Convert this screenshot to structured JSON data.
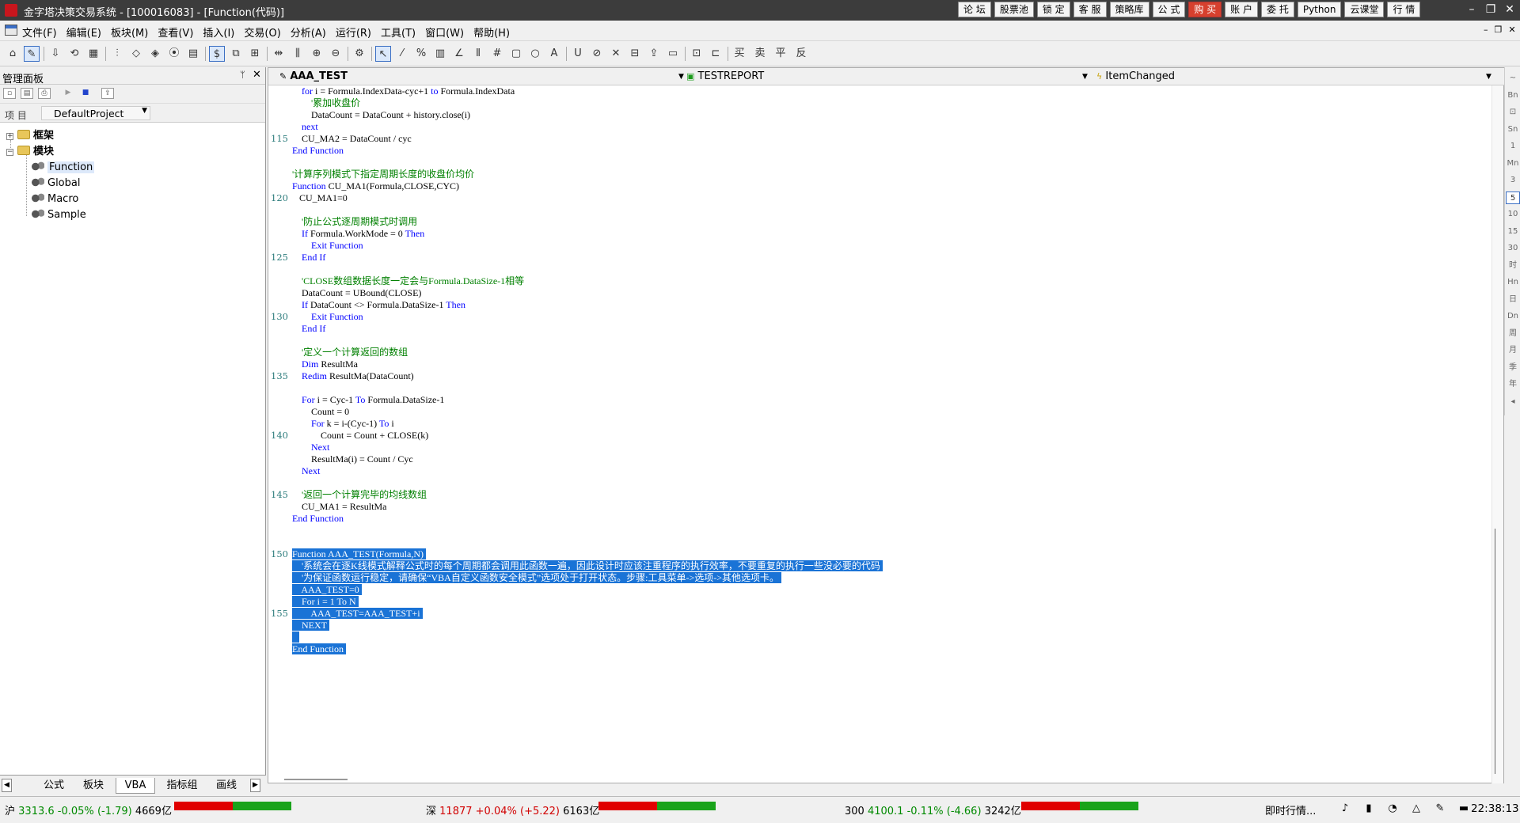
{
  "window": {
    "title": "金字塔决策交易系统 - [100016083] - [Function(代码)]"
  },
  "top_links": [
    "论 坛",
    "股票池",
    "锁 定",
    "客 服",
    "策略库",
    "公 式",
    "购 买",
    "账 户",
    "委 托",
    "Python",
    "云课堂",
    "行 情"
  ],
  "window_controls": [
    "–",
    "❐",
    "✕"
  ],
  "menu": [
    "文件(F)",
    "编辑(E)",
    "板块(M)",
    "查看(V)",
    "插入(I)",
    "交易(O)",
    "分析(A)",
    "运行(R)",
    "工具(T)",
    "窗口(W)",
    "帮助(H)"
  ],
  "mdi_controls": [
    "–",
    "❐",
    "✕"
  ],
  "toolbar_glyphs": [
    "⌂",
    "✎",
    "⇩",
    "⟲",
    "▦",
    "⫶",
    "◇",
    "◈",
    "⦿",
    "▤",
    "$",
    "⧉",
    "⊞",
    "⇹",
    "⫼",
    "⊕",
    "⊖",
    "⚙",
    "↖",
    "⁄",
    "%",
    "▥",
    "∠",
    "⫴",
    "#",
    "▢",
    "○",
    "A",
    "U",
    "⊘",
    "✕",
    "⊟",
    "⇪",
    "▭",
    "⊡",
    "⊏",
    "买",
    "卖",
    "平",
    "反"
  ],
  "panel": {
    "title": "管理面板",
    "pin": "ᛘ",
    "close": "✕",
    "project_label": "项  目",
    "project_value": "DefaultProject",
    "tree": [
      {
        "label": "框架",
        "toggle": "+"
      },
      {
        "label": "模块",
        "toggle": "−"
      },
      {
        "label": "Function"
      },
      {
        "label": "Global"
      },
      {
        "label": "Macro"
      },
      {
        "label": "Sample"
      }
    ],
    "tabs": [
      "公式",
      "板块",
      "VBA",
      "指标组",
      "画线"
    ],
    "tab_arrows": [
      "◀",
      "▶"
    ]
  },
  "editor": {
    "object_combo": "AAA_TEST",
    "report_combo": "TESTREPORT",
    "event_combo": "ItemChanged"
  },
  "line_numbers": [
    "115",
    "120",
    "125",
    "130",
    "135",
    "140",
    "145",
    "150",
    "155"
  ],
  "code_lines": [
    [
      {
        "t": "    "
      },
      {
        "t": "for",
        "k": "kw"
      },
      {
        "t": " i = Formula.IndexData-cyc+1 "
      },
      {
        "t": "to",
        "k": "kw"
      },
      {
        "t": " Formula.IndexData"
      }
    ],
    [
      {
        "t": "        "
      },
      {
        "t": "'累加收盘价",
        "k": "cm"
      }
    ],
    [
      {
        "t": "        DataCount = DataCount + history.close(i)"
      }
    ],
    [
      {
        "t": "    "
      },
      {
        "t": "next",
        "k": "kw"
      }
    ],
    [
      {
        "t": "    CU_MA2 = DataCount / cyc"
      }
    ],
    [
      {
        "t": "End Function",
        "k": "kw"
      }
    ],
    [
      {
        "t": ""
      }
    ],
    [
      {
        "t": "'计算序列模式下指定周期长度的收盘价均价",
        "k": "cm"
      }
    ],
    [
      {
        "t": "Function",
        "k": "kw"
      },
      {
        "t": " CU_MA1(Formula,CLOSE,CYC)"
      }
    ],
    [
      {
        "t": "   CU_MA1=0"
      }
    ],
    [
      {
        "t": ""
      }
    ],
    [
      {
        "t": "    "
      },
      {
        "t": "'防止公式逐周期模式时调用",
        "k": "cm"
      }
    ],
    [
      {
        "t": "    "
      },
      {
        "t": "If",
        "k": "kw"
      },
      {
        "t": " Formula.WorkMode = 0 "
      },
      {
        "t": "Then",
        "k": "kw"
      }
    ],
    [
      {
        "t": "        "
      },
      {
        "t": "Exit Function",
        "k": "kw"
      }
    ],
    [
      {
        "t": "    "
      },
      {
        "t": "End If",
        "k": "kw"
      }
    ],
    [
      {
        "t": ""
      }
    ],
    [
      {
        "t": "    "
      },
      {
        "t": "'CLOSE数组数据长度一定会与Formula.DataSize-1相等",
        "k": "cm"
      }
    ],
    [
      {
        "t": "    DataCount = UBound(CLOSE)"
      }
    ],
    [
      {
        "t": "    "
      },
      {
        "t": "If",
        "k": "kw"
      },
      {
        "t": " DataCount <> Formula.DataSize-1 "
      },
      {
        "t": "Then",
        "k": "kw"
      }
    ],
    [
      {
        "t": "        "
      },
      {
        "t": "Exit Function",
        "k": "kw"
      }
    ],
    [
      {
        "t": "    "
      },
      {
        "t": "End If",
        "k": "kw"
      }
    ],
    [
      {
        "t": ""
      }
    ],
    [
      {
        "t": "    "
      },
      {
        "t": "'定义一个计算返回的数组",
        "k": "cm"
      }
    ],
    [
      {
        "t": "    "
      },
      {
        "t": "Dim",
        "k": "kw"
      },
      {
        "t": " ResultMa"
      }
    ],
    [
      {
        "t": "    "
      },
      {
        "t": "Redim",
        "k": "kw"
      },
      {
        "t": " ResultMa(DataCount)"
      }
    ],
    [
      {
        "t": ""
      }
    ],
    [
      {
        "t": "    "
      },
      {
        "t": "For",
        "k": "kw"
      },
      {
        "t": " i = Cyc-1 "
      },
      {
        "t": "To",
        "k": "kw"
      },
      {
        "t": " Formula.DataSize-1"
      }
    ],
    [
      {
        "t": "        Count = 0"
      }
    ],
    [
      {
        "t": "        "
      },
      {
        "t": "For",
        "k": "kw"
      },
      {
        "t": " k = i-(Cyc-1) "
      },
      {
        "t": "To",
        "k": "kw"
      },
      {
        "t": " i"
      }
    ],
    [
      {
        "t": "            Count = Count + CLOSE(k)"
      }
    ],
    [
      {
        "t": "        "
      },
      {
        "t": "Next",
        "k": "kw"
      }
    ],
    [
      {
        "t": "        ResultMa(i) = Count / Cyc"
      }
    ],
    [
      {
        "t": "    "
      },
      {
        "t": "Next",
        "k": "kw"
      }
    ],
    [
      {
        "t": ""
      }
    ],
    [
      {
        "t": "    "
      },
      {
        "t": "'返回一个计算完毕的均线数组",
        "k": "cm"
      }
    ],
    [
      {
        "t": "    CU_MA1 = ResultMa"
      }
    ],
    [
      {
        "t": "End Function",
        "k": "kw"
      }
    ],
    [
      {
        "t": ""
      }
    ],
    [
      {
        "t": ""
      }
    ],
    [
      {
        "t": "Function AAA_TEST(Formula,N) ",
        "k": "hl"
      }
    ],
    [
      {
        "t": "    '系统会在逐K线模式解释公式时的每个周期都会调用此函数一遍，因此设计时应该注重程序的执行效率，不要重复的执行一些没必要的代码 ",
        "k": "hl"
      }
    ],
    [
      {
        "t": "    '为保证函数运行稳定，请确保“VBA自定义函数安全模式”选项处于打开状态。步骤:工具菜单->选项->其他选项卡。 ",
        "k": "hl"
      }
    ],
    [
      {
        "t": "    AAA_TEST=0 ",
        "k": "hl"
      }
    ],
    [
      {
        "t": "    For i = 1 To N ",
        "k": "hl"
      }
    ],
    [
      {
        "t": "        AAA_TEST=AAA_TEST+i ",
        "k": "hl"
      }
    ],
    [
      {
        "t": "    NEXT ",
        "k": "hl"
      }
    ],
    [
      {
        "t": "   ",
        "k": "hl"
      }
    ],
    [
      {
        "t": "End Function ",
        "k": "hl"
      }
    ]
  ],
  "right_bar": [
    "∼",
    "Bn",
    "⊡",
    "Sn",
    "1",
    "Mn",
    "3",
    "5",
    "10",
    "15",
    "30",
    "时",
    "Hn",
    "日",
    "Dn",
    "周",
    "月",
    "季",
    "年",
    "◂"
  ],
  "status": {
    "sh": {
      "label": "沪",
      "value": "3313.6",
      "pct": "-0.05%",
      "chg": "(-1.79)",
      "amount": "4669亿",
      "red_frac": 0.5
    },
    "sz": {
      "label": "深",
      "value": "11877",
      "pct": "+0.04%",
      "chg": "(+5.22)",
      "amount": "6163亿",
      "red_frac": 0.5
    },
    "i300": {
      "label": "300",
      "value": "4100.1",
      "pct": "-0.11%",
      "chg": "(-4.66)",
      "amount": "3242亿",
      "red_frac": 0.5
    },
    "realtime": "即时行情...",
    "icons": [
      "♪",
      "▮",
      "◔",
      "△",
      "✎",
      "▬"
    ],
    "time": "22:38:13"
  }
}
